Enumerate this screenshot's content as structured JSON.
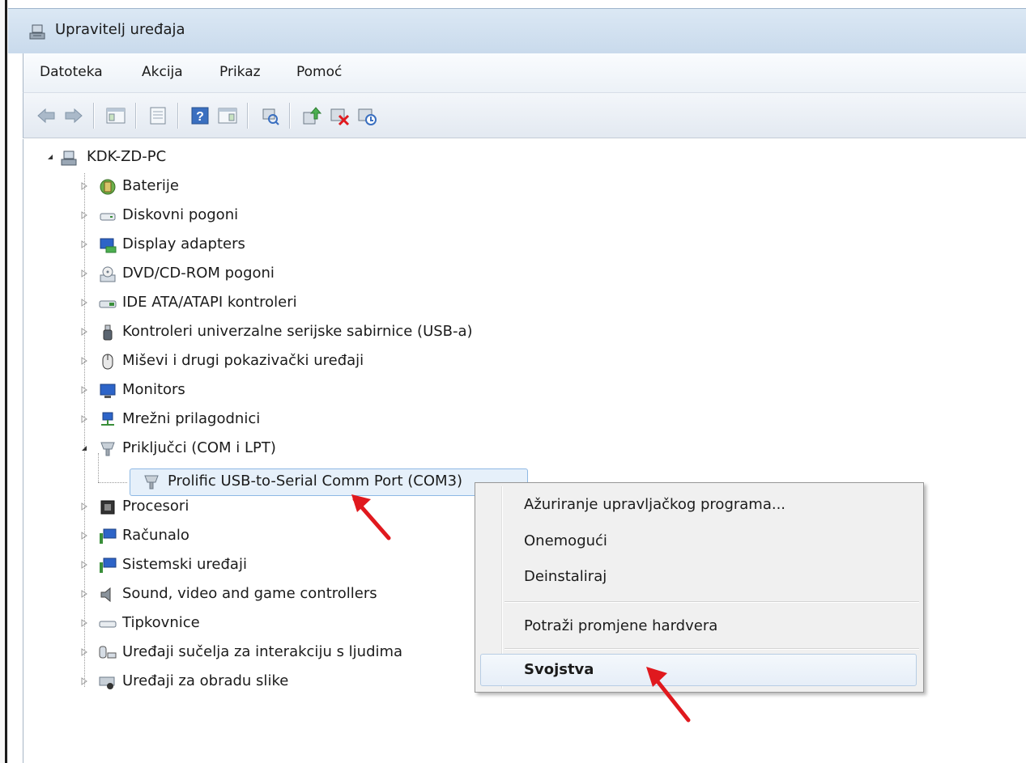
{
  "window": {
    "title": "Upravitelj uređaja"
  },
  "menu": [
    "Datoteka",
    "Akcija",
    "Prikaz",
    "Pomoć"
  ],
  "toolbar": [
    {
      "name": "back-icon"
    },
    {
      "name": "forward-icon"
    },
    {
      "name": "show-hide-console-tree-icon"
    },
    {
      "name": "properties-icon"
    },
    {
      "name": "help-icon"
    },
    {
      "name": "show-action-pane-icon"
    },
    {
      "name": "scan-hardware-icon"
    },
    {
      "name": "update-driver-icon"
    },
    {
      "name": "uninstall-icon"
    },
    {
      "name": "disable-icon"
    }
  ],
  "tree": {
    "root": "KDK-ZD-PC",
    "categories": [
      "Baterije",
      "Diskovni pogoni",
      "Display adapters",
      "DVD/CD-ROM pogoni",
      "IDE ATA/ATAPI kontroleri",
      "Kontroleri univerzalne serijske sabirnice (USB-a)",
      "Miševi i drugi pokazivački uređaji",
      "Monitors",
      "Mrežni prilagodnici",
      "Priključci (COM i LPT)",
      "Procesori",
      "Računalo",
      "Sistemski uređaji",
      "Sound, video and game controllers",
      "Tipkovnice",
      "Uređaji sučelja za interakciju s ljudima",
      "Uređaji za obradu slike"
    ],
    "expanded_child": "Prolific USB-to-Serial Comm Port (COM3)"
  },
  "context_menu": {
    "items": [
      "Ažuriranje upravljačkog programa...",
      "Onemogući",
      "Deinstaliraj",
      "Potraži promjene hardvera",
      "Svojstva"
    ]
  },
  "colors": {
    "selection": "#e6f0fa",
    "annotation_arrow": "#e0191e"
  }
}
